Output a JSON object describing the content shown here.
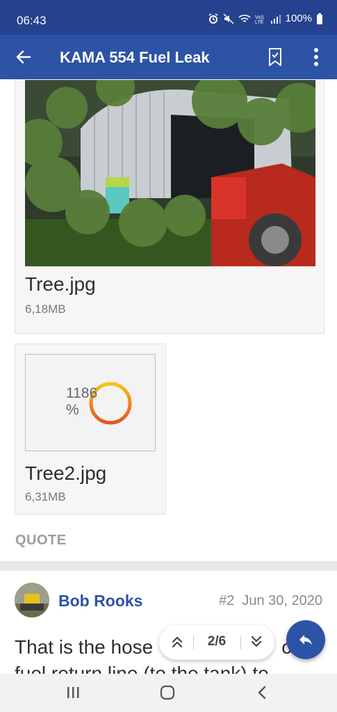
{
  "status_bar": {
    "time": "06:43",
    "battery": "100%"
  },
  "app_bar": {
    "title": "KAMA 554 Fuel Leak",
    "icons": [
      "back-arrow-icon",
      "bookmark-icon",
      "more-vert-icon"
    ]
  },
  "attachments": [
    {
      "filename": "Tree.jpg",
      "size": "6,18MB"
    },
    {
      "filename": "Tree2.jpg",
      "size": "6,31MB",
      "progress_label": "1186 %"
    }
  ],
  "quote_label": "QUOTE",
  "post": {
    "author": "Bob Rooks",
    "number": "#2",
    "date": "Jun 30, 2020",
    "text_line1": "That is the hose",
    "text_line1_end": "ct",
    "text_line2": "fuel return line (to the tank) to"
  },
  "pager": {
    "current": "2/6"
  },
  "colors": {
    "status_bar": "#24428e",
    "app_bar": "#2d53a6",
    "accent": "#2d53a6",
    "spinner_start": "#f5c21b",
    "spinner_end": "#e8511f"
  }
}
